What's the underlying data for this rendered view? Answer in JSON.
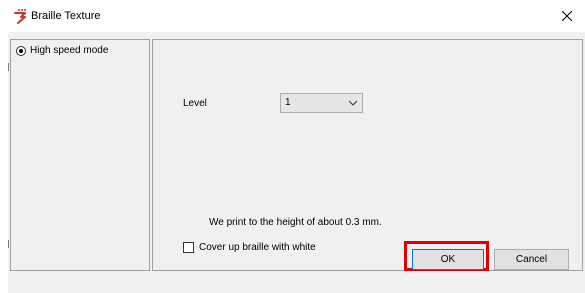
{
  "window": {
    "title": "Braille Texture",
    "icon": "braille-app-icon",
    "close_icon": "close-icon"
  },
  "mode_panel": {
    "options": [
      {
        "label": "High speed mode",
        "selected": true
      }
    ]
  },
  "settings": {
    "level_label": "Level",
    "level_value": "1",
    "note": "We print to the height of about 0.3 mm.",
    "cover_label": "Cover up braille with white",
    "cover_checked": false
  },
  "buttons": {
    "ok": "OK",
    "cancel": "Cancel"
  },
  "colors": {
    "highlight": "#e00000",
    "accent": "#0078d7"
  }
}
